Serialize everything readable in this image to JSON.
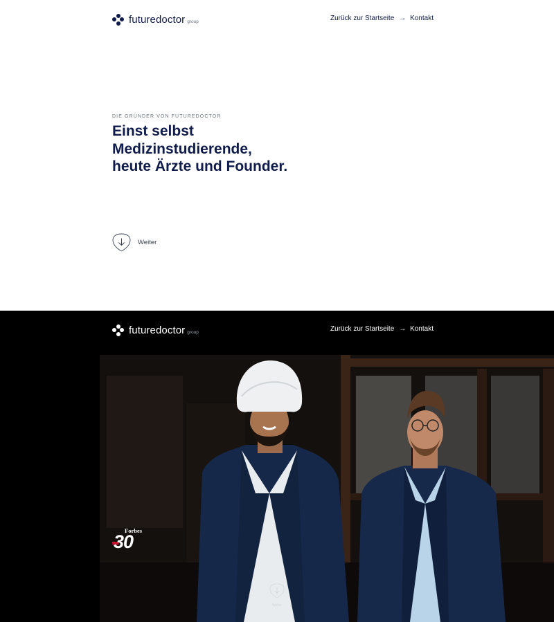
{
  "header": {
    "logo_text": "futuredoctor",
    "logo_sub": "group",
    "back_link": "Zurück zur Startseite",
    "contact_link": "Kontakt"
  },
  "hero": {
    "eyebrow": "DIE GRÜNDER VON FUTUREDOCTOR",
    "headline_lines": [
      "Einst selbst",
      "Medizinstudierende,",
      "heute Ärzte und Founder."
    ],
    "next_label": "Weiter"
  },
  "section2": {
    "badge": {
      "word": "Forbes",
      "number": "30"
    },
    "scroll_label": "Weiter"
  },
  "colors": {
    "brand_navy": "#0f1b4a",
    "forbes_red": "#c8102e"
  }
}
